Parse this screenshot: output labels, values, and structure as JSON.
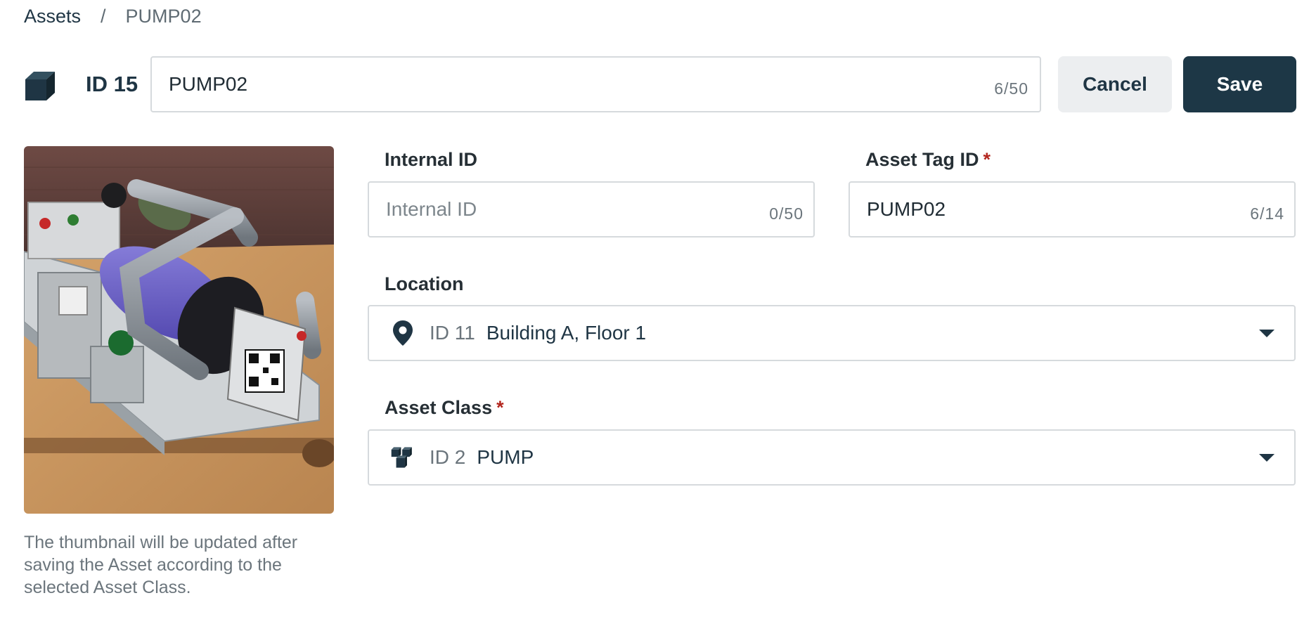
{
  "breadcrumb": {
    "root": "Assets",
    "separator": "/",
    "current": "PUMP02"
  },
  "header": {
    "icon": "cube-icon",
    "id_label": "ID 15",
    "name_value": "PUMP02",
    "name_counter": "6/50",
    "cancel_label": "Cancel",
    "save_label": "Save"
  },
  "thumbnail": {
    "alt": "Pump asset photo",
    "note": "The thumbnail will be updated after saving the Asset according to the selected Asset Class."
  },
  "fields": {
    "internal_id": {
      "label": "Internal ID",
      "placeholder": "Internal ID",
      "value": "",
      "counter": "0/50"
    },
    "asset_tag_id": {
      "label": "Asset Tag ID",
      "required_mark": "*",
      "value": "PUMP02",
      "counter": "6/14"
    },
    "location": {
      "label": "Location",
      "icon": "map-pin-icon",
      "id_text": "ID 11",
      "value": "Building A, Floor 1"
    },
    "asset_class": {
      "label": "Asset Class",
      "required_mark": "*",
      "icon": "cubes-icon",
      "id_text": "ID 2",
      "value": "PUMP"
    }
  },
  "colors": {
    "primary": "#1d3746",
    "required": "#b3261e",
    "border": "#d6dadd",
    "muted": "#6b757c"
  }
}
